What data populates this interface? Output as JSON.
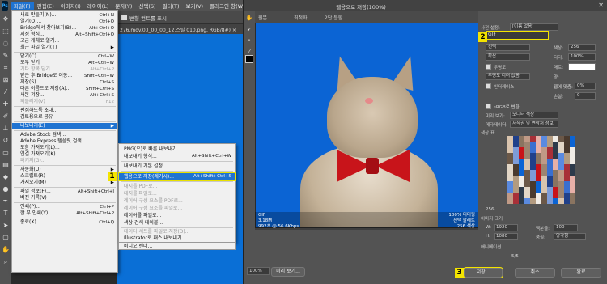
{
  "menubar": {
    "logo": "Ps",
    "items": [
      "파일(F)",
      "편집(E)",
      "이미지(I)",
      "레이어(L)",
      "문자(Y)",
      "선택(S)",
      "필터(T)",
      "보기(V)",
      "플러그인 창(W)"
    ]
  },
  "optbar": {
    "checkbox_label": "변형 컨트롤 표시"
  },
  "doctab": {
    "label": "276.mov.00_00_00_12.스틸 010.png, RGB/8#) ×"
  },
  "filemenu": {
    "items": [
      {
        "label": "새로 만들기(N)...",
        "shortcut": "Ctrl+N"
      },
      {
        "label": "열기(O)...",
        "shortcut": "Ctrl+O"
      },
      {
        "label": "Bridge에서 찾아보기(B)...",
        "shortcut": "Alt+Ctrl+O"
      },
      {
        "label": "지정 형식...",
        "shortcut": "Alt+Shift+Ctrl+O"
      },
      {
        "label": "고급 개체로 열기...",
        "shortcut": ""
      },
      {
        "label": "최근 파일 열기(T)",
        "shortcut": "▶"
      },
      {
        "label": "닫기(C)",
        "shortcut": "Ctrl+W"
      },
      {
        "label": "모두 닫기",
        "shortcut": "Alt+Ctrl+W"
      },
      {
        "label": "기타 항목 닫기",
        "shortcut": "Alt+Ctrl+P"
      },
      {
        "label": "닫은 후 Bridge로 이동...",
        "shortcut": "Shift+Ctrl+W"
      },
      {
        "label": "저장(S)",
        "shortcut": "Ctrl+S"
      },
      {
        "label": "다른 이름으로 저장(A)...",
        "shortcut": "Shift+Ctrl+S"
      },
      {
        "label": "사본 저장...",
        "shortcut": "Alt+Ctrl+S"
      },
      {
        "label": "되돌리기(V)",
        "shortcut": "F12"
      },
      {
        "label": "편집하도록 초대...",
        "shortcut": ""
      },
      {
        "label": "검토용으로 공유",
        "shortcut": ""
      },
      {
        "label": "내보내기(E)",
        "shortcut": "▶"
      },
      {
        "label": "Adobe Stock 검색...",
        "shortcut": ""
      },
      {
        "label": "Adobe Express 템플릿 검색...",
        "shortcut": ""
      },
      {
        "label": "포함 가져오기(L)...",
        "shortcut": ""
      },
      {
        "label": "연결 가져오기(K)...",
        "shortcut": ""
      },
      {
        "label": "패키지(G)...",
        "shortcut": ""
      },
      {
        "label": "자동화(U)",
        "shortcut": "▶"
      },
      {
        "label": "스크립트(R)",
        "shortcut": "▶"
      },
      {
        "label": "가져오기(M)",
        "shortcut": "▶"
      },
      {
        "label": "파일 정보(F)...",
        "shortcut": "Alt+Shift+Ctrl+I"
      },
      {
        "label": "버전 기록(V)",
        "shortcut": ""
      },
      {
        "label": "인쇄(P)...",
        "shortcut": "Ctrl+P"
      },
      {
        "label": "한 부 인쇄(Y)",
        "shortcut": "Alt+Shift+Ctrl+P"
      },
      {
        "label": "종료(X)",
        "shortcut": "Ctrl+Q"
      }
    ]
  },
  "submenu": {
    "items": [
      {
        "label": "PNG(으)로 빠른 내보내기",
        "shortcut": ""
      },
      {
        "label": "내보내기 형식...",
        "shortcut": "Alt+Shift+Ctrl+W"
      },
      {
        "label": "내보내기 기본 설정...",
        "shortcut": ""
      },
      {
        "label": "웹용으로 저장(레거시)...",
        "shortcut": "Alt+Shift+Ctrl+S"
      },
      {
        "label": "대지를 PDF로...",
        "shortcut": ""
      },
      {
        "label": "대지를 파일로...",
        "shortcut": ""
      },
      {
        "label": "레이어 구성 요소를 PDF로...",
        "shortcut": ""
      },
      {
        "label": "레이어 구성 요소를 파일로...",
        "shortcut": ""
      },
      {
        "label": "레이어를 파일로...",
        "shortcut": ""
      },
      {
        "label": "색상 검색 테이블...",
        "shortcut": ""
      },
      {
        "label": "데이터 세트를 파일로 저장(D)...",
        "shortcut": ""
      },
      {
        "label": "Illustrator로 패스 내보내기...",
        "shortcut": ""
      },
      {
        "label": "비디오 렌더...",
        "shortcut": ""
      }
    ]
  },
  "badges": {
    "b1": "1",
    "b2": "2",
    "b3": "3"
  },
  "dialog": {
    "title": "웹용으로 저장(100%)",
    "tabs": [
      "원본",
      "최적화",
      "2단 분할"
    ],
    "preview_info_left": [
      "GIF",
      "3.18M",
      "992초 @ 56.6Kbps"
    ],
    "preview_info_right": [
      "100% 디더링",
      "선택 팔레트",
      "256 색상"
    ],
    "zoom": "100%",
    "buttons": {
      "save": "저장...",
      "cancel": "취소",
      "done": "완료",
      "preview": "미리 보기..."
    },
    "panel": {
      "preset_label": "사전 설정:",
      "preset_value": "[이름 없음]",
      "format": "GIF",
      "reduction": "선택",
      "colors_label": "색상:",
      "colors_value": "256",
      "dither_algo": "확산",
      "dither_label": "디더:",
      "dither_value": "100%",
      "transparency": "투명도",
      "matte_label": "매트:",
      "no_transparency_dither": "투명도 디더 없음",
      "amount_label": "양:",
      "interlaced": "인터레이스",
      "web_snap_label": "웹에 맞춤:",
      "web_snap_value": "0%",
      "lossy_label": "손실:",
      "lossy_value": "0",
      "srgb": "sRGB로 변환",
      "preview_label": "미리 보기:",
      "preview_value": "모니터 색상",
      "metadata_label": "메타데이터:",
      "metadata_value": "저작권 및 연락처 정보",
      "color_table": "색상 표",
      "color_count": "256",
      "image_size": "이미지 크기",
      "w_label": "W:",
      "w_value": "1920",
      "h_label": "H:",
      "h_value": "1080",
      "percent_label": "백분율:",
      "percent_value": "100",
      "quality_label": "품질:",
      "quality_value": "양각형",
      "animation": "애니메이션",
      "frame": "5/5"
    }
  }
}
